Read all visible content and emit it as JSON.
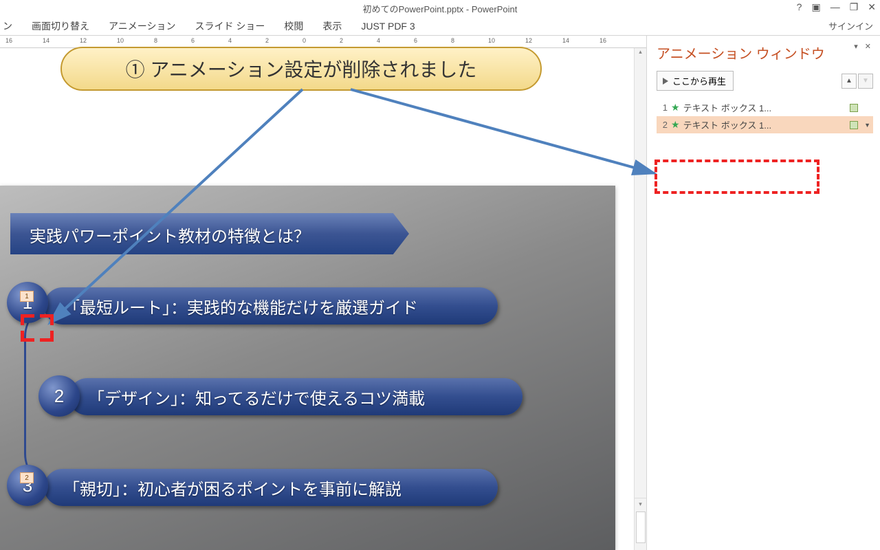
{
  "title": "初めてのPowerPoint.pptx - PowerPoint",
  "signin": "サインイン",
  "tabs": [
    "ン",
    "画面切り替え",
    "アニメーション",
    "スライド ショー",
    "校閲",
    "表示",
    "JUST PDF 3"
  ],
  "ruler_labels": [
    "16",
    "14",
    "12",
    "10",
    "8",
    "6",
    "4",
    "2",
    "0",
    "2",
    "4",
    "6",
    "8",
    "10",
    "12",
    "14",
    "16"
  ],
  "callout": "① アニメーション設定が削除されました",
  "slide": {
    "title": "実践パワーポイント教材の特徴とは？",
    "items": [
      "「最短ルート」：実践的な機能だけを厳選ガイド",
      "「デザイン」：知ってるだけで使えるコツ満載",
      "「親切」：初心者が困るポイントを事前に解説"
    ],
    "circles": [
      "1",
      "2",
      "3"
    ],
    "tags": [
      "1",
      "2"
    ]
  },
  "pane": {
    "title": "アニメーション ウィンドウ",
    "play": "ここから再生",
    "items": [
      {
        "num": "1",
        "label": "テキスト ボックス 1..."
      },
      {
        "num": "2",
        "label": "テキスト ボックス 1..."
      }
    ]
  }
}
